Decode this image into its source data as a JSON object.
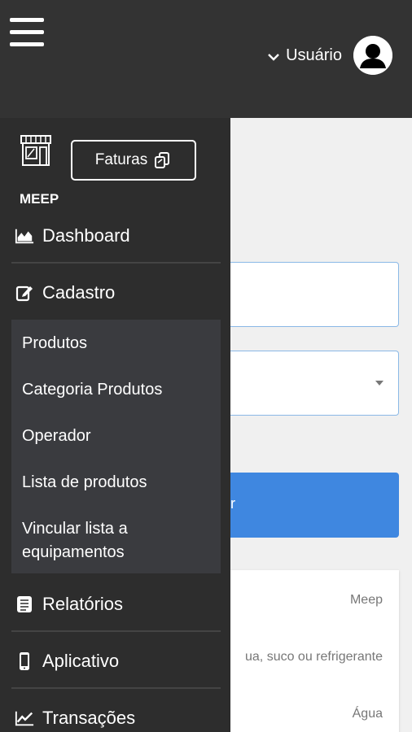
{
  "header": {
    "user_label": "Usuário"
  },
  "drawer": {
    "brand": "MEEP",
    "faturas_label": "Faturas",
    "items": [
      {
        "label": "Dashboard",
        "icon": "area-chart-icon"
      },
      {
        "label": "Cadastro",
        "icon": "edit-icon"
      },
      {
        "label": "Relatórios",
        "icon": "list-icon"
      },
      {
        "label": "Aplicativo",
        "icon": "mobile-icon"
      },
      {
        "label": "Transações",
        "icon": "line-chart-icon"
      }
    ],
    "submenu": [
      {
        "label": "Produtos"
      },
      {
        "label": "Categoria Produtos"
      },
      {
        "label": "Operador"
      },
      {
        "label": "Lista de produtos"
      },
      {
        "label": "Vincular lista a"
      },
      {
        "label": "equipamentos"
      }
    ]
  },
  "content": {
    "button_fragment": "r",
    "card_lines": [
      "Meep",
      "ua, suco ou refrigerante",
      "Água"
    ]
  },
  "colors": {
    "topbar": "#333333",
    "drawer": "#2d2d2d",
    "submenu": "#3a3b3f",
    "accent": "#3f87e0"
  }
}
